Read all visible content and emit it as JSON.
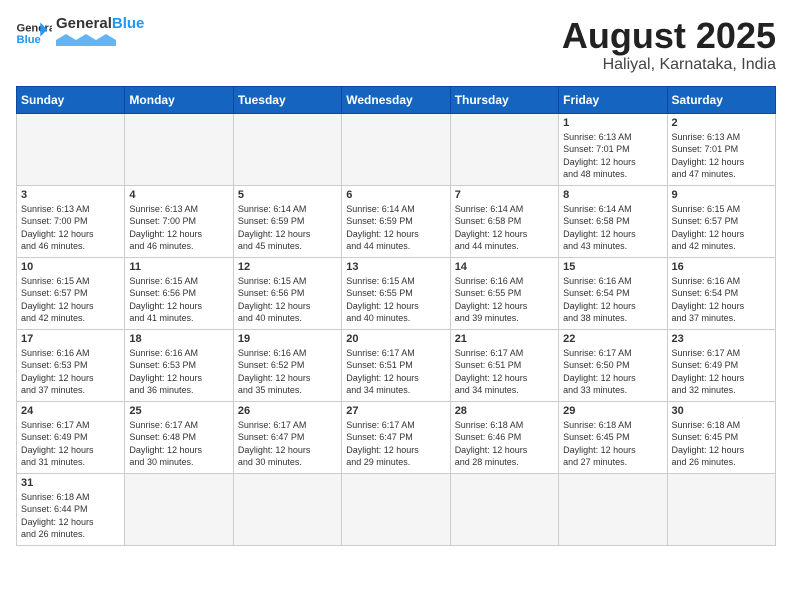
{
  "header": {
    "logo_general": "General",
    "logo_blue": "Blue",
    "month": "August 2025",
    "location": "Haliyal, Karnataka, India"
  },
  "days_of_week": [
    "Sunday",
    "Monday",
    "Tuesday",
    "Wednesday",
    "Thursday",
    "Friday",
    "Saturday"
  ],
  "weeks": [
    [
      {
        "day": "",
        "info": ""
      },
      {
        "day": "",
        "info": ""
      },
      {
        "day": "",
        "info": ""
      },
      {
        "day": "",
        "info": ""
      },
      {
        "day": "",
        "info": ""
      },
      {
        "day": "1",
        "info": "Sunrise: 6:13 AM\nSunset: 7:01 PM\nDaylight: 12 hours\nand 48 minutes."
      },
      {
        "day": "2",
        "info": "Sunrise: 6:13 AM\nSunset: 7:01 PM\nDaylight: 12 hours\nand 47 minutes."
      }
    ],
    [
      {
        "day": "3",
        "info": "Sunrise: 6:13 AM\nSunset: 7:00 PM\nDaylight: 12 hours\nand 46 minutes."
      },
      {
        "day": "4",
        "info": "Sunrise: 6:13 AM\nSunset: 7:00 PM\nDaylight: 12 hours\nand 46 minutes."
      },
      {
        "day": "5",
        "info": "Sunrise: 6:14 AM\nSunset: 6:59 PM\nDaylight: 12 hours\nand 45 minutes."
      },
      {
        "day": "6",
        "info": "Sunrise: 6:14 AM\nSunset: 6:59 PM\nDaylight: 12 hours\nand 44 minutes."
      },
      {
        "day": "7",
        "info": "Sunrise: 6:14 AM\nSunset: 6:58 PM\nDaylight: 12 hours\nand 44 minutes."
      },
      {
        "day": "8",
        "info": "Sunrise: 6:14 AM\nSunset: 6:58 PM\nDaylight: 12 hours\nand 43 minutes."
      },
      {
        "day": "9",
        "info": "Sunrise: 6:15 AM\nSunset: 6:57 PM\nDaylight: 12 hours\nand 42 minutes."
      }
    ],
    [
      {
        "day": "10",
        "info": "Sunrise: 6:15 AM\nSunset: 6:57 PM\nDaylight: 12 hours\nand 42 minutes."
      },
      {
        "day": "11",
        "info": "Sunrise: 6:15 AM\nSunset: 6:56 PM\nDaylight: 12 hours\nand 41 minutes."
      },
      {
        "day": "12",
        "info": "Sunrise: 6:15 AM\nSunset: 6:56 PM\nDaylight: 12 hours\nand 40 minutes."
      },
      {
        "day": "13",
        "info": "Sunrise: 6:15 AM\nSunset: 6:55 PM\nDaylight: 12 hours\nand 40 minutes."
      },
      {
        "day": "14",
        "info": "Sunrise: 6:16 AM\nSunset: 6:55 PM\nDaylight: 12 hours\nand 39 minutes."
      },
      {
        "day": "15",
        "info": "Sunrise: 6:16 AM\nSunset: 6:54 PM\nDaylight: 12 hours\nand 38 minutes."
      },
      {
        "day": "16",
        "info": "Sunrise: 6:16 AM\nSunset: 6:54 PM\nDaylight: 12 hours\nand 37 minutes."
      }
    ],
    [
      {
        "day": "17",
        "info": "Sunrise: 6:16 AM\nSunset: 6:53 PM\nDaylight: 12 hours\nand 37 minutes."
      },
      {
        "day": "18",
        "info": "Sunrise: 6:16 AM\nSunset: 6:53 PM\nDaylight: 12 hours\nand 36 minutes."
      },
      {
        "day": "19",
        "info": "Sunrise: 6:16 AM\nSunset: 6:52 PM\nDaylight: 12 hours\nand 35 minutes."
      },
      {
        "day": "20",
        "info": "Sunrise: 6:17 AM\nSunset: 6:51 PM\nDaylight: 12 hours\nand 34 minutes."
      },
      {
        "day": "21",
        "info": "Sunrise: 6:17 AM\nSunset: 6:51 PM\nDaylight: 12 hours\nand 34 minutes."
      },
      {
        "day": "22",
        "info": "Sunrise: 6:17 AM\nSunset: 6:50 PM\nDaylight: 12 hours\nand 33 minutes."
      },
      {
        "day": "23",
        "info": "Sunrise: 6:17 AM\nSunset: 6:49 PM\nDaylight: 12 hours\nand 32 minutes."
      }
    ],
    [
      {
        "day": "24",
        "info": "Sunrise: 6:17 AM\nSunset: 6:49 PM\nDaylight: 12 hours\nand 31 minutes."
      },
      {
        "day": "25",
        "info": "Sunrise: 6:17 AM\nSunset: 6:48 PM\nDaylight: 12 hours\nand 30 minutes."
      },
      {
        "day": "26",
        "info": "Sunrise: 6:17 AM\nSunset: 6:47 PM\nDaylight: 12 hours\nand 30 minutes."
      },
      {
        "day": "27",
        "info": "Sunrise: 6:17 AM\nSunset: 6:47 PM\nDaylight: 12 hours\nand 29 minutes."
      },
      {
        "day": "28",
        "info": "Sunrise: 6:18 AM\nSunset: 6:46 PM\nDaylight: 12 hours\nand 28 minutes."
      },
      {
        "day": "29",
        "info": "Sunrise: 6:18 AM\nSunset: 6:45 PM\nDaylight: 12 hours\nand 27 minutes."
      },
      {
        "day": "30",
        "info": "Sunrise: 6:18 AM\nSunset: 6:45 PM\nDaylight: 12 hours\nand 26 minutes."
      }
    ],
    [
      {
        "day": "31",
        "info": "Sunrise: 6:18 AM\nSunset: 6:44 PM\nDaylight: 12 hours\nand 26 minutes."
      },
      {
        "day": "",
        "info": ""
      },
      {
        "day": "",
        "info": ""
      },
      {
        "day": "",
        "info": ""
      },
      {
        "day": "",
        "info": ""
      },
      {
        "day": "",
        "info": ""
      },
      {
        "day": "",
        "info": ""
      }
    ]
  ]
}
